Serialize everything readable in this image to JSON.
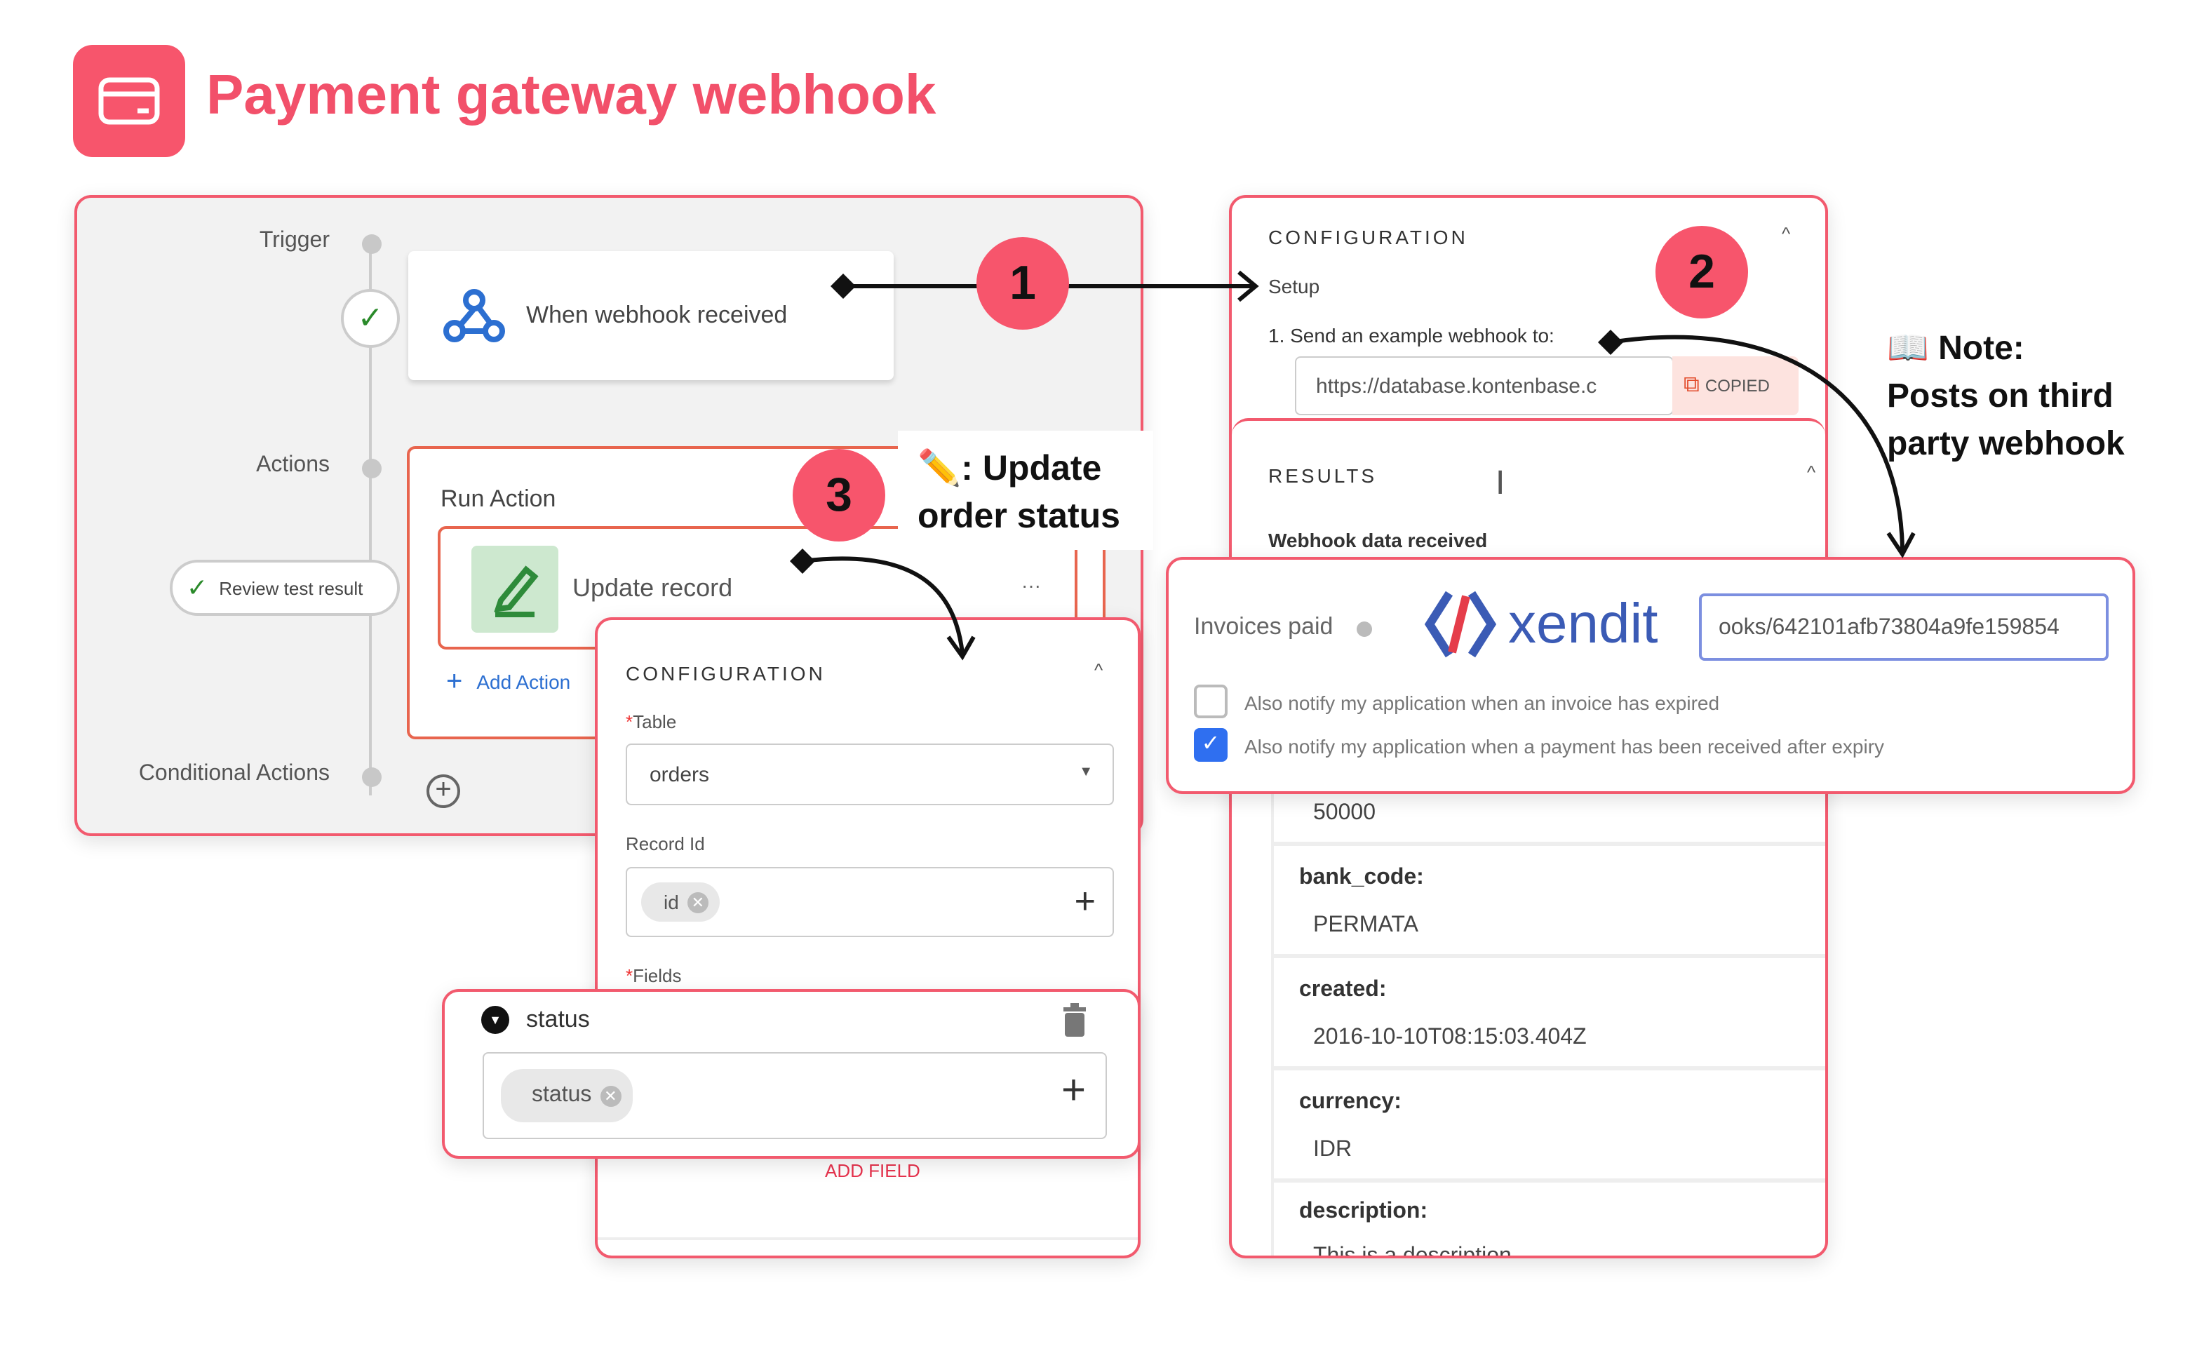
{
  "header": {
    "title": "Payment gateway webhook",
    "icon": "credit-card-icon",
    "accent": "#f7556c"
  },
  "workflow": {
    "trigger_label": "Trigger",
    "trigger_card": "When webhook received",
    "actions_label": "Actions",
    "run_action": "Run Action",
    "update_record": "Update record",
    "more": "···",
    "add_action": "Add Action",
    "review": "Review test result",
    "conditional": "Conditional Actions"
  },
  "callouts": {
    "one": "1",
    "two": "2",
    "three": "3",
    "update_note": ": Update order status",
    "note_title": "Note:",
    "note_body": "Posts on third party webhook"
  },
  "config_mid": {
    "title": "CONFIGURATION",
    "table_label": "Table",
    "table_value": "orders",
    "record_label": "Record Id",
    "record_chip": "id",
    "fields_label": "Fields",
    "add_field": "ADD FIELD"
  },
  "status_field": {
    "name": "status",
    "chip": "status"
  },
  "config_right": {
    "title": "CONFIGURATION",
    "setup": "Setup",
    "step": "1. Send an example webhook to:",
    "url": "https://database.kontenbase.c",
    "copied": "COPIED"
  },
  "results": {
    "title": "RESULTS",
    "subtitle": "Webhook data received",
    "amount": "50000",
    "rows": [
      {
        "key": "bank_code:",
        "value": "PERMATA"
      },
      {
        "key": "created:",
        "value": "2016-10-10T08:15:03.404Z"
      },
      {
        "key": "currency:",
        "value": "IDR"
      },
      {
        "key": "description:",
        "value": "This is a description"
      }
    ]
  },
  "xendit": {
    "label": "Invoices paid",
    "brand": "xendit",
    "url_value": "ooks/642101afb73804a9fe159854",
    "opt1": "Also notify my application when an invoice has expired",
    "opt1_checked": false,
    "opt2": "Also notify my application when a payment has been received after expiry",
    "opt2_checked": true
  }
}
